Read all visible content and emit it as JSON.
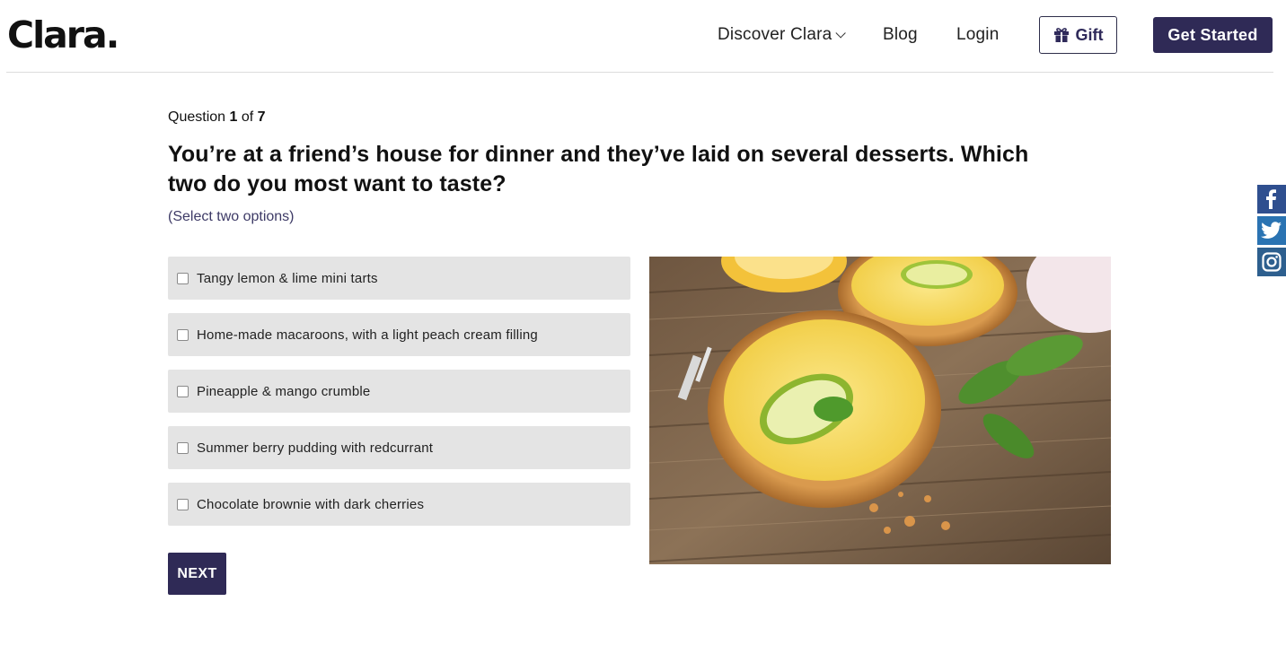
{
  "header": {
    "logo": "Clara.",
    "nav": {
      "discover": "Discover Clara",
      "blog": "Blog",
      "login": "Login"
    },
    "gift_label": "Gift",
    "get_started_label": "Get Started"
  },
  "quiz": {
    "counter_prefix": "Question",
    "current": "1",
    "of_word": "of",
    "total": "7",
    "question": "You’re at a friend’s house for dinner and they’ve laid on several desserts. Which two do you most want to taste?",
    "hint": "(Select two options)",
    "options": [
      {
        "label": "Tangy lemon & lime mini tarts",
        "checked": false
      },
      {
        "label": "Home-made macaroons, with a light peach cream filling",
        "checked": false
      },
      {
        "label": "Pineapple & mango crumble",
        "checked": false
      },
      {
        "label": "Summer berry pudding with redcurrant",
        "checked": false
      },
      {
        "label": "Chocolate brownie with dark cherries",
        "checked": false
      }
    ],
    "next_label": "NEXT"
  },
  "social": {
    "icons": [
      "facebook-icon",
      "twitter-icon",
      "instagram-icon"
    ]
  },
  "colors": {
    "brand": "#2f2a56",
    "option_bg": "#e4e4e4",
    "facebook": "#2f4f8f",
    "twitter": "#2a73b2",
    "instagram": "#2d5f8e"
  }
}
